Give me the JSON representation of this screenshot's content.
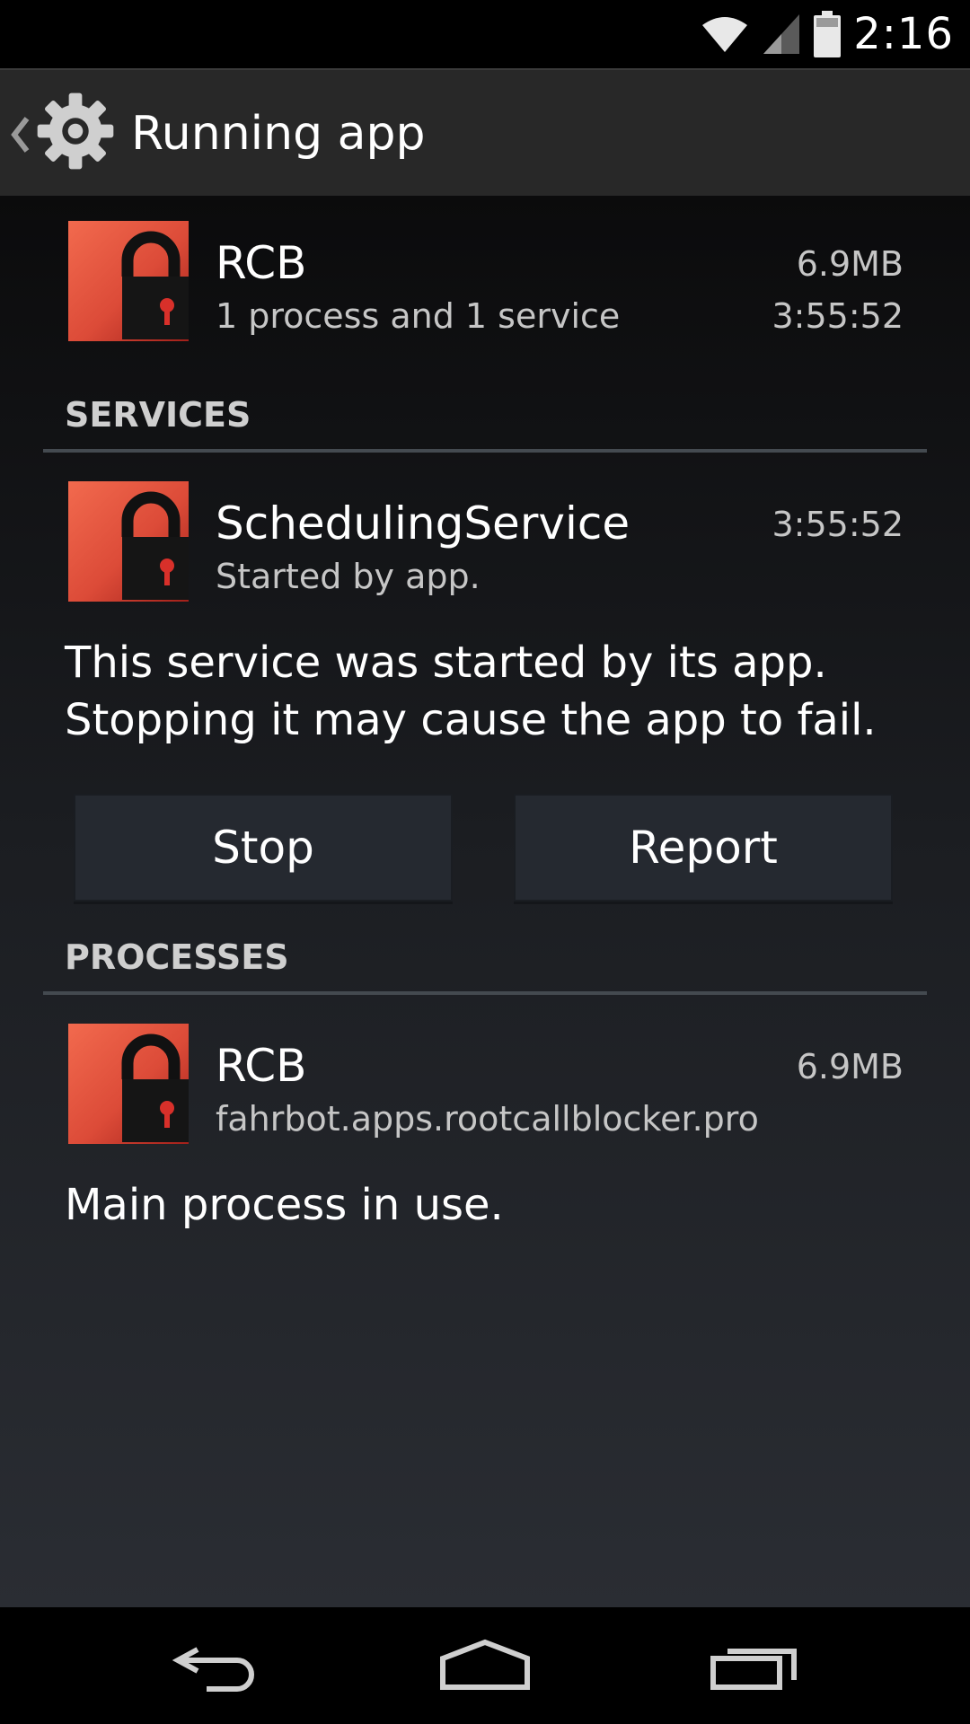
{
  "status": {
    "time": "2:16"
  },
  "header": {
    "title": "Running app"
  },
  "app": {
    "name": "RCB",
    "summary": "1 process and 1 service",
    "memory": "6.9MB",
    "uptime": "3:55:52"
  },
  "services": {
    "header": "SERVICES",
    "item": {
      "name": "SchedulingService",
      "status": "Started by app.",
      "time": "3:55:52"
    },
    "description_line1": "This service was started by its app.",
    "description_line2": "Stopping it may cause the app to fail.",
    "stop_label": "Stop",
    "report_label": "Report"
  },
  "processes": {
    "header": "PROCESSES",
    "item": {
      "name": "RCB",
      "package": "fahrbot.apps.rootcallblocker.pro",
      "memory": "6.9MB"
    },
    "description": "Main process in use."
  },
  "icons": {
    "app_icon": "red-padlock-icon",
    "settings": "gear-icon",
    "back": "back-arrow-icon",
    "home": "home-icon",
    "recents": "recents-icon"
  },
  "colors": {
    "icon_red": "#e2533e",
    "divider": "#444a50",
    "button_bg": "#252930"
  }
}
